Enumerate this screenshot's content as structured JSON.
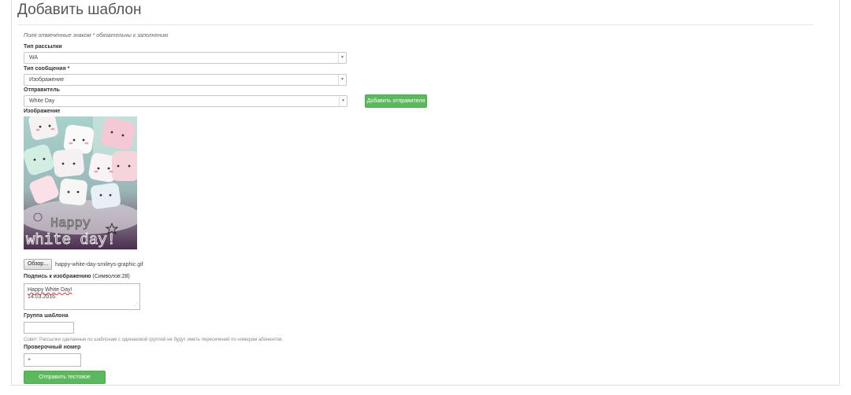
{
  "page": {
    "title": "Добавить шаблон",
    "required_hint": "Поля отмеченные знаком * обязательны к заполнению"
  },
  "form": {
    "mailing_type": {
      "label": "Тип рассылки",
      "value": "WA"
    },
    "message_type": {
      "label": "Тип сообщения *",
      "value": "Изображение"
    },
    "sender": {
      "label": "Отправитель",
      "value": "White Day",
      "add_button": "Добавить отправителя"
    },
    "image": {
      "label": "Изображение",
      "picture_text_line1": "Happy",
      "picture_text_line2": "white day!",
      "browse_button": "Обзор...",
      "filename": "happy-white-day-smileys-graphic.gif"
    },
    "caption": {
      "label": "Подпись к изображению",
      "counter": "(Символов:28)",
      "line1": "Happy White Day!",
      "line2": "14.03.2016."
    },
    "template_group": {
      "label": "Группа шаблона",
      "value": "",
      "advice": "Совет: Рассылки сделанные по шаблонам с одинаковой группой не будут иметь пересечений по номерам абонентов."
    },
    "test_number": {
      "label": "Проверочный номер",
      "value": "+"
    },
    "send_test_button": "Отправить тестовое сообщение"
  },
  "colors": {
    "accent_green": "#5cb85c",
    "title_text": "#555555"
  }
}
